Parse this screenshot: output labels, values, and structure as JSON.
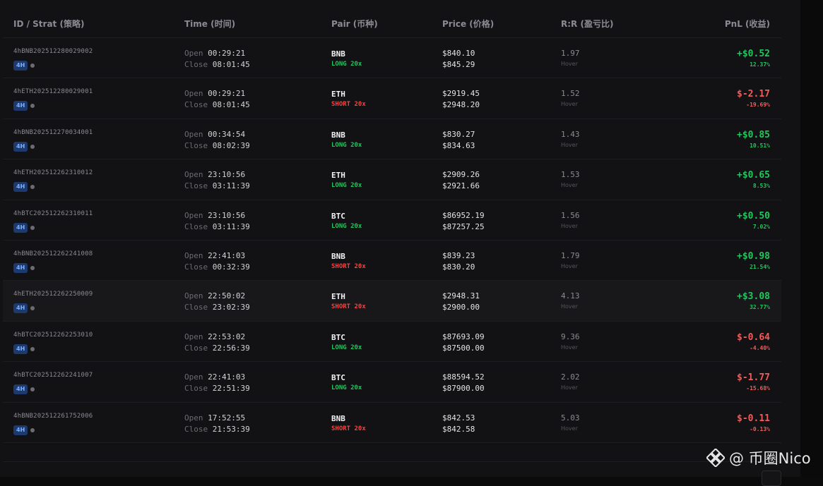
{
  "header": {
    "id": "ID / Strat (策略)",
    "time": "Time (时间)",
    "pair": "Pair (币种)",
    "price": "Price (价格)",
    "rr": "R:R (盈亏比)",
    "pnl": "PnL (收益)"
  },
  "labels": {
    "open": "Open",
    "close": "Close",
    "hover": "Hover"
  },
  "colors": {
    "profit": "#22c55e",
    "loss": "#f15c5c",
    "badge": "#1c3a6e"
  },
  "watermark": {
    "text": "@ 币圈Nico",
    "icon": "binance-logo-icon"
  },
  "trades": [
    {
      "id": "4hBNB202512280029002",
      "tf": "4H",
      "open": "00:29:21",
      "close": "08:01:45",
      "pair": "BNB",
      "side": "LONG 20x",
      "dir": "long",
      "entry": "$840.10",
      "exit": "$845.29",
      "rr": "1.97",
      "pnl": "+$0.52",
      "pct": "12.37%",
      "res": "pos"
    },
    {
      "id": "4hETH202512280029001",
      "tf": "4H",
      "open": "00:29:21",
      "close": "08:01:45",
      "pair": "ETH",
      "side": "SHORT 20x",
      "dir": "short",
      "entry": "$2919.45",
      "exit": "$2948.20",
      "rr": "1.52",
      "pnl": "$-2.17",
      "pct": "-19.69%",
      "res": "neg"
    },
    {
      "id": "4hBNB202512270034001",
      "tf": "4H",
      "open": "00:34:54",
      "close": "08:02:39",
      "pair": "BNB",
      "side": "LONG 20x",
      "dir": "long",
      "entry": "$830.27",
      "exit": "$834.63",
      "rr": "1.43",
      "pnl": "+$0.85",
      "pct": "10.51%",
      "res": "pos"
    },
    {
      "id": "4hETH202512262310012",
      "tf": "4H",
      "open": "23:10:56",
      "close": "03:11:39",
      "pair": "ETH",
      "side": "LONG 20x",
      "dir": "long",
      "entry": "$2909.26",
      "exit": "$2921.66",
      "rr": "1.53",
      "pnl": "+$0.65",
      "pct": "8.53%",
      "res": "pos"
    },
    {
      "id": "4hBTC202512262310011",
      "tf": "4H",
      "open": "23:10:56",
      "close": "03:11:39",
      "pair": "BTC",
      "side": "LONG 20x",
      "dir": "long",
      "entry": "$86952.19",
      "exit": "$87257.25",
      "rr": "1.56",
      "pnl": "+$0.50",
      "pct": "7.02%",
      "res": "pos"
    },
    {
      "id": "4hBNB202512262241008",
      "tf": "4H",
      "open": "22:41:03",
      "close": "00:32:39",
      "pair": "BNB",
      "side": "SHORT 20x",
      "dir": "short",
      "entry": "$839.23",
      "exit": "$830.20",
      "rr": "1.79",
      "pnl": "+$0.98",
      "pct": "21.54%",
      "res": "pos"
    },
    {
      "id": "4hETH202512262250009",
      "tf": "4H",
      "open": "22:50:02",
      "close": "23:02:39",
      "pair": "ETH",
      "side": "SHORT 20x",
      "dir": "short",
      "entry": "$2948.31",
      "exit": "$2900.00",
      "rr": "4.13",
      "pnl": "+$3.08",
      "pct": "32.77%",
      "res": "pos",
      "highlight": true
    },
    {
      "id": "4hBTC202512262253010",
      "tf": "4H",
      "open": "22:53:02",
      "close": "22:56:39",
      "pair": "BTC",
      "side": "LONG 20x",
      "dir": "long",
      "entry": "$87693.09",
      "exit": "$87500.00",
      "rr": "9.36",
      "pnl": "$-0.64",
      "pct": "-4.40%",
      "res": "neg"
    },
    {
      "id": "4hBTC202512262241007",
      "tf": "4H",
      "open": "22:41:03",
      "close": "22:51:39",
      "pair": "BTC",
      "side": "LONG 20x",
      "dir": "long",
      "entry": "$88594.52",
      "exit": "$87900.00",
      "rr": "2.02",
      "pnl": "$-1.77",
      "pct": "-15.68%",
      "res": "neg"
    },
    {
      "id": "4hBNB202512261752006",
      "tf": "4H",
      "open": "17:52:55",
      "close": "21:53:39",
      "pair": "BNB",
      "side": "SHORT 20x",
      "dir": "short",
      "entry": "$842.53",
      "exit": "$842.58",
      "rr": "5.03",
      "pnl": "$-0.11",
      "pct": "-0.13%",
      "res": "neg"
    }
  ]
}
